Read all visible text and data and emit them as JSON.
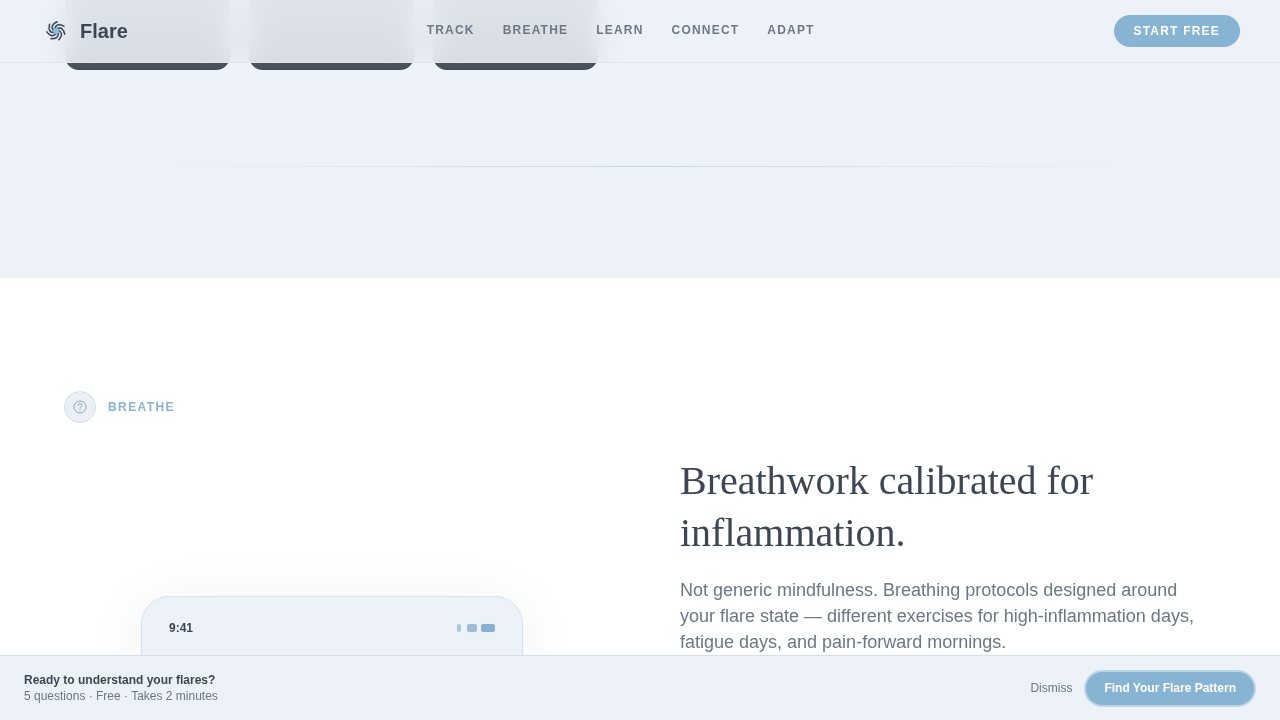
{
  "header": {
    "logo": "Flare",
    "nav": [
      "TRACK",
      "BREATHE",
      "LEARN",
      "CONNECT",
      "ADAPT"
    ],
    "cta": "START FREE"
  },
  "photo_strip": [
    {
      "kind": "photo"
    },
    {
      "kind": "photo"
    },
    {
      "kind": "photo"
    }
  ],
  "breathe": {
    "eyebrow": "BREATHE",
    "phone": {
      "time": "9:41"
    },
    "heading": "Breathwork calibrated for inflammation.",
    "body": "Not generic mindfulness. Breathing protocols designed around your flare state — different exercises for high-inflammation days, fatigue days, and pain-forward mornings."
  },
  "bottom_bar": {
    "title": "Ready to understand your flares?",
    "subtitle": "5 questions · Free · Takes 2 minutes",
    "dismiss": "Dismiss",
    "button": "Find Your Flare Pattern"
  }
}
